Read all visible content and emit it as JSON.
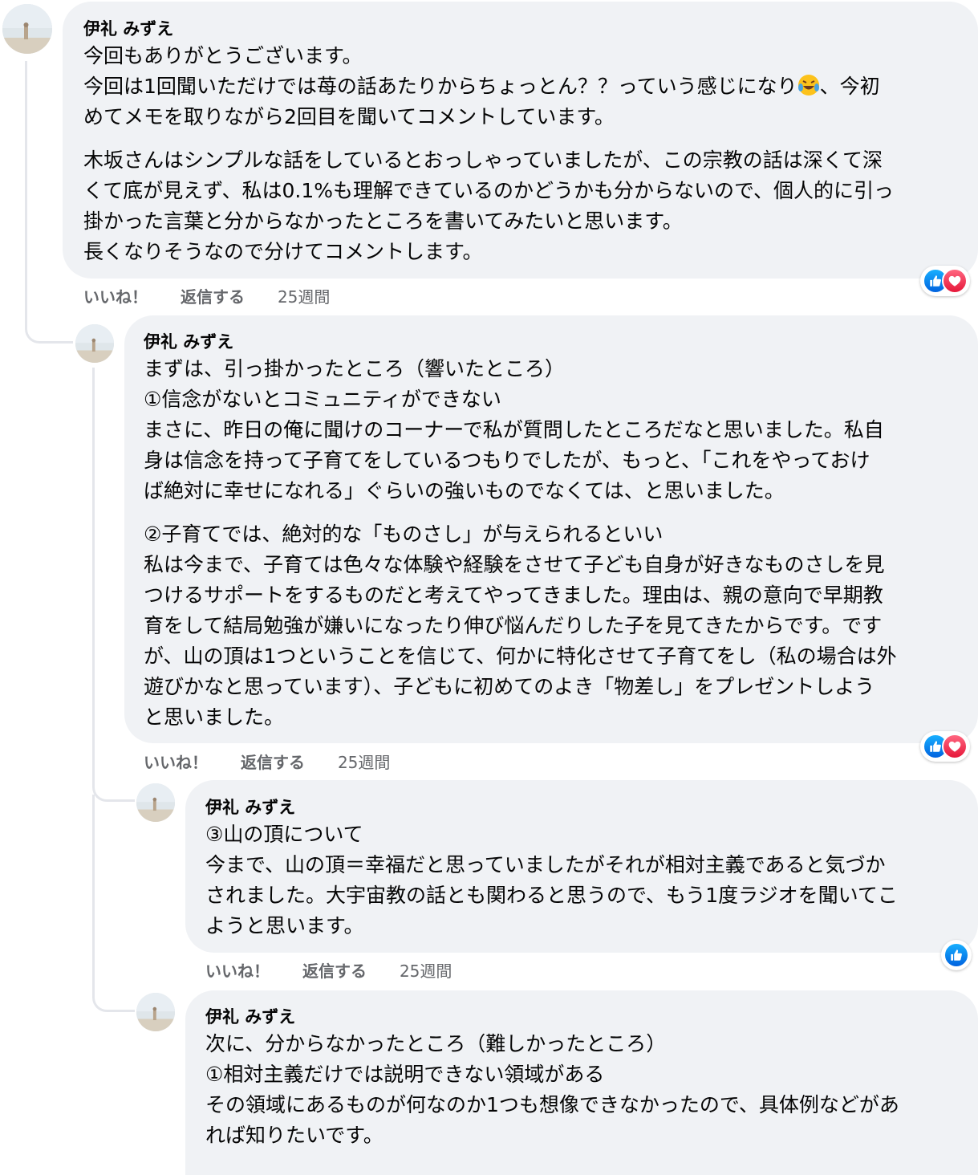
{
  "comments": [
    {
      "author": "伊礼 みずえ",
      "paragraphs": [
        [
          "今回もありがとうございます。",
          "今回は1回聞いただけでは苺の話あたりからちょっとん？？っていう感じになり",
          "めてメモを取りながら2回目を聞いてコメントしています。"
        ],
        [
          "木坂さんはシンプルな話をしているとおっしゃっていましたが、この宗教の話は深くて深",
          "くて底が見えず、私は0.1%も理解できているのかどうかも分からないので、個人的に引っ",
          "掛かった言葉と分からなかったところを書いてみたいと思います。",
          "長くなりそうなので分けてコメントします。"
        ]
      ],
      "line2_suffix": "、今初",
      "emoji": "laughing-crying-emoji",
      "actions": {
        "like": "いいね！",
        "reply": "返信する",
        "time": "25週間"
      },
      "reactions": [
        "like",
        "love"
      ]
    },
    {
      "author": "伊礼 みずえ",
      "paragraphs": [
        [
          "まずは、引っ掛かったところ（響いたところ）",
          "①信念がないとコミュニティができない",
          "まさに、昨日の俺に聞けのコーナーで私が質問したところだなと思いました。私自",
          "身は信念を持って子育てをしているつもりでしたが、もっと、「これをやっておけ",
          "ば絶対に幸せになれる」ぐらいの強いものでなくては、と思いました。"
        ],
        [
          "②子育てでは、絶対的な「ものさし」が与えられるといい",
          "私は今まで、子育ては色々な体験や経験をさせて子ども自身が好きなものさしを見",
          "つけるサポートをするものだと考えてやってきました。理由は、親の意向で早期教",
          "育をして結局勉強が嫌いになったり伸び悩んだりした子を見てきたからです。です",
          "が、山の頂は1つということを信じて、何かに特化させて子育てをし（私の場合は外",
          "遊びかなと思っています）、子どもに初めてのよき「物差し」をプレゼントしよう",
          "と思いました。"
        ]
      ],
      "actions": {
        "like": "いいね！",
        "reply": "返信する",
        "time": "25週間"
      },
      "reactions": [
        "like",
        "love"
      ]
    },
    {
      "author": "伊礼 みずえ",
      "paragraphs": [
        [
          "③山の頂について",
          "今まで、山の頂＝幸福だと思っていましたがそれが相対主義であると気づか",
          "されました。大宇宙教の話とも関わると思うので、もう1度ラジオを聞いてこ",
          "ようと思います。"
        ]
      ],
      "actions": {
        "like": "いいね！",
        "reply": "返信する",
        "time": "25週間"
      },
      "reactions": [
        "like"
      ]
    },
    {
      "author": "伊礼 みずえ",
      "paragraphs": [
        [
          "次に、分からなかったところ（難しかったところ）",
          "①相対主義だけでは説明できない領域がある",
          "その領域にあるものが何なのか1つも想像できなかったので、具体例などがあ",
          "れば知りたいです。"
        ]
      ]
    }
  ],
  "icons": {
    "like": "thumbs-up-icon",
    "love": "heart-icon",
    "avatar": "beach-photo-avatar"
  },
  "colors": {
    "bubble": "#f0f2f5",
    "meta": "#65676b",
    "like": "#1877f2",
    "love": "#f33e58"
  }
}
